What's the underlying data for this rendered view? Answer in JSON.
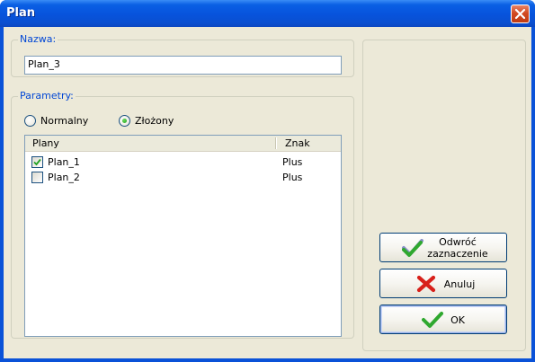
{
  "window": {
    "title": "Plan"
  },
  "name_group": {
    "legend": "Nazwa:",
    "value": "Plan_3"
  },
  "params_group": {
    "legend": "Parametry:",
    "radio_normal": "Normalny",
    "radio_complex": "Złożony",
    "selected": "complex"
  },
  "plans_list": {
    "columns": [
      "Plany",
      "Znak"
    ],
    "rows": [
      {
        "name": "Plan_1",
        "sign": "Plus",
        "checked": true
      },
      {
        "name": "Plan_2",
        "sign": "Plus",
        "checked": false
      }
    ]
  },
  "buttons": {
    "invert_line1": "Odwróć",
    "invert_line2": "zaznaczenie",
    "cancel": "Anuluj",
    "ok": "OK"
  },
  "icons": {
    "close": "close-icon",
    "check": "checkmark-icon",
    "cancel": "red-x-icon"
  },
  "colors": {
    "title_bar": "#0753dc",
    "legend_text": "#0046d5",
    "face": "#ece9d8"
  }
}
